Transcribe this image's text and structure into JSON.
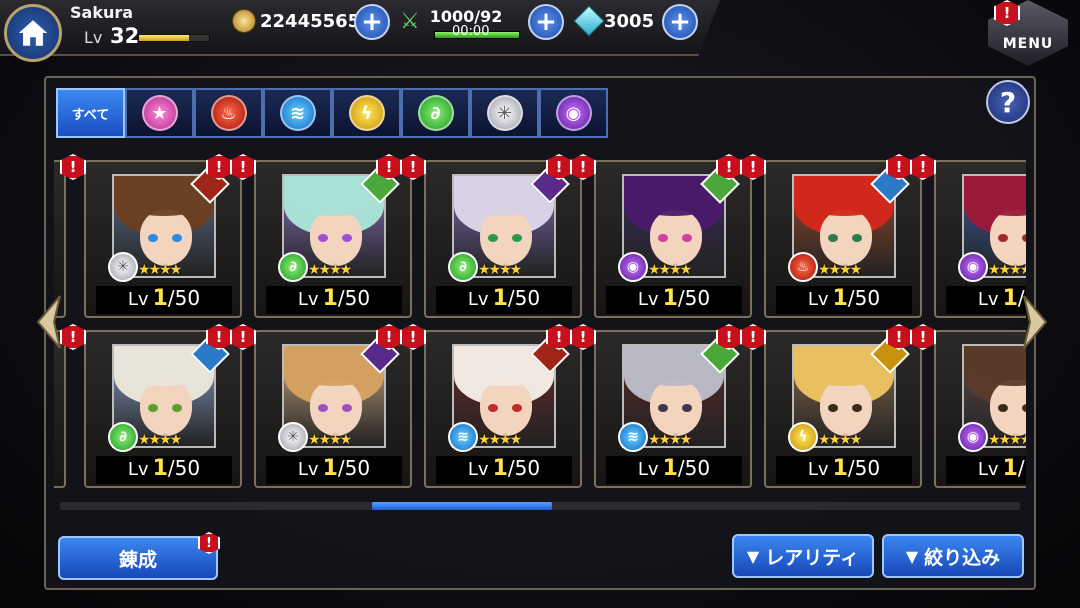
{
  "player": {
    "name": "Sakura",
    "level_label": "Lv",
    "level": "32",
    "exp_fraction": 0.72
  },
  "resources": {
    "coins": "22445565",
    "stamina": "1000/92",
    "stamina_timer": "00:00",
    "stamina_fraction": 1.0,
    "gems": "3005"
  },
  "menu": {
    "label": "MENU",
    "badge": "!"
  },
  "help": {
    "label": "?"
  },
  "tabs": [
    {
      "label": "すべて",
      "icon": "all",
      "active": true
    },
    {
      "label": "",
      "icon": "star-element-icon"
    },
    {
      "label": "",
      "icon": "fire-element-icon"
    },
    {
      "label": "",
      "icon": "water-element-icon"
    },
    {
      "label": "",
      "icon": "thunder-element-icon"
    },
    {
      "label": "",
      "icon": "wind-element-icon"
    },
    {
      "label": "",
      "icon": "light-element-icon"
    },
    {
      "label": "",
      "icon": "dark-element-icon"
    }
  ],
  "level_text": {
    "prefix": "Lv",
    "current": "1",
    "max": "/50"
  },
  "badge_text": "!",
  "cards": [
    {
      "element": "light",
      "hair": "#6b3f22",
      "bg": "#5a6e8a",
      "eye": "#2f8be0",
      "role": "#a12418"
    },
    {
      "element": "wind",
      "hair": "#a9e0d6",
      "bg": "#8a70b8",
      "eye": "#a050d0",
      "role": "#4aa83a"
    },
    {
      "element": "wind",
      "hair": "#d9d2e6",
      "bg": "#7d6ab0",
      "eye": "#2a9a4a",
      "role": "#5a2a8a"
    },
    {
      "element": "dark",
      "hair": "#4a1a6a",
      "bg": "#3a2a5a",
      "eye": "#d040a0",
      "role": "#4aa83a"
    },
    {
      "element": "fire",
      "hair": "#d2281c",
      "bg": "#9a4a2a",
      "eye": "#2a7a4a",
      "role": "#2a7ac8"
    },
    {
      "element": "dark",
      "hair": "#9a1a3a",
      "bg": "#3a5a9a",
      "eye": "#a02a2a",
      "role": "#a12418"
    },
    {
      "element": "wind",
      "hair": "#e8e4da",
      "bg": "#8aa0c8",
      "eye": "#5aa02a",
      "role": "#2a7ac8"
    },
    {
      "element": "light",
      "hair": "#d4a060",
      "bg": "#c8a880",
      "eye": "#a050c0",
      "role": "#5a2a8a"
    },
    {
      "element": "water",
      "hair": "#f0e8e0",
      "bg": "#6a2a2a",
      "eye": "#c02a2a",
      "role": "#a12418"
    },
    {
      "element": "water",
      "hair": "#b8b8c4",
      "bg": "#5a2a2a",
      "eye": "#3a3a4a",
      "role": "#4aa83a"
    },
    {
      "element": "thunder",
      "hair": "#e8c060",
      "bg": "#8a6a4a",
      "eye": "#3a2a1a",
      "role": "#c8920a"
    },
    {
      "element": "dark",
      "hair": "#5a3a2a",
      "bg": "#5a4a4a",
      "eye": "#3a2a1a",
      "role": "#a12418"
    }
  ],
  "buttons": {
    "refine": "錬成",
    "rarity": "レアリティ",
    "filter": "絞り込み"
  },
  "scroll_position": 0.3
}
